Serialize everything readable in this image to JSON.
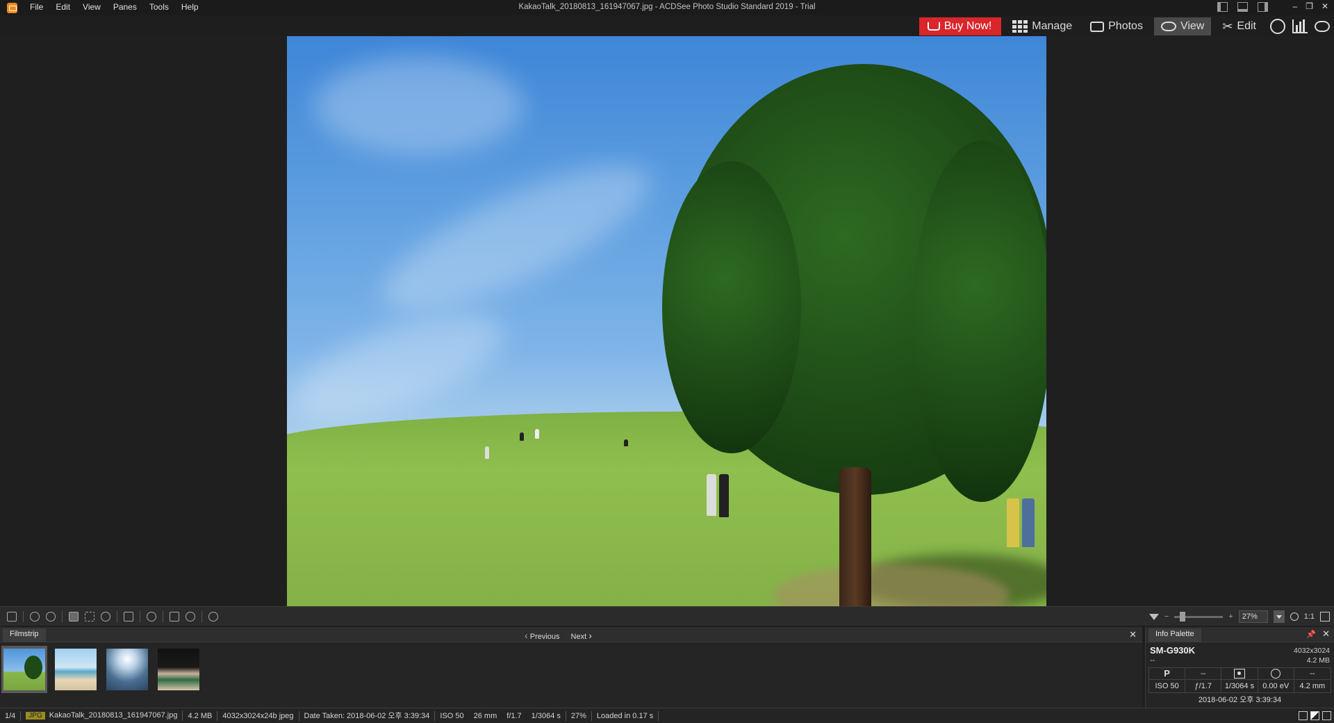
{
  "window": {
    "title": "KakaoTalk_20180813_161947067.jpg - ACDSee Photo Studio Standard 2019 - Trial",
    "menu": [
      "File",
      "Edit",
      "View",
      "Panes",
      "Tools",
      "Help"
    ],
    "controls": [
      "‒",
      "❐",
      "✕"
    ]
  },
  "modes": {
    "buy_now": "Buy Now!",
    "manage": "Manage",
    "photos": "Photos",
    "view": "View",
    "edit": "Edit",
    "active": "View"
  },
  "viewer_toolbar": {
    "zoom_percent": "27%",
    "one_to_one": "1:1"
  },
  "filmstrip": {
    "tab": "Filmstrip",
    "previous": "Previous",
    "next": "Next",
    "close": "✕",
    "thumbnails": [
      {
        "name": "tree-on-hill",
        "selected": true
      },
      {
        "name": "beach",
        "selected": false
      },
      {
        "name": "sea-sunlight",
        "selected": false
      },
      {
        "name": "hands-cans",
        "selected": false
      }
    ]
  },
  "info_palette": {
    "tab": "Info Palette",
    "camera": "SM-G930K",
    "dimensions": "4032x3024",
    "lens": "--",
    "file_size": "4.2 MB",
    "row1": [
      "P",
      "--",
      "metering-icon",
      "flash-icon",
      "--"
    ],
    "row2": [
      "ISO 50",
      "ƒ/1.7",
      "1/3064 s",
      "0.00 eV",
      "4.2 mm"
    ],
    "date": "2018-06-02 오후 3:39:34",
    "close": "✕"
  },
  "status": {
    "index": "1/4",
    "format": "JPG",
    "filename": "KakaoTalk_20180813_161947067.jpg",
    "size": "4.2 MB",
    "info": "4032x3024x24b jpeg",
    "date_taken": "Date Taken: 2018-06-02 오후 3:39:34",
    "iso": "ISO 50",
    "focal": "26 mm",
    "aperture": "f/1.7",
    "shutter": "1/3064 s",
    "zoom": "27%",
    "loaded": "Loaded in 0.17 s"
  },
  "colors": {
    "accent_buy": "#d9262b",
    "active_mode": "#4a4a4a",
    "jpg_badge": "#9a8c22"
  }
}
